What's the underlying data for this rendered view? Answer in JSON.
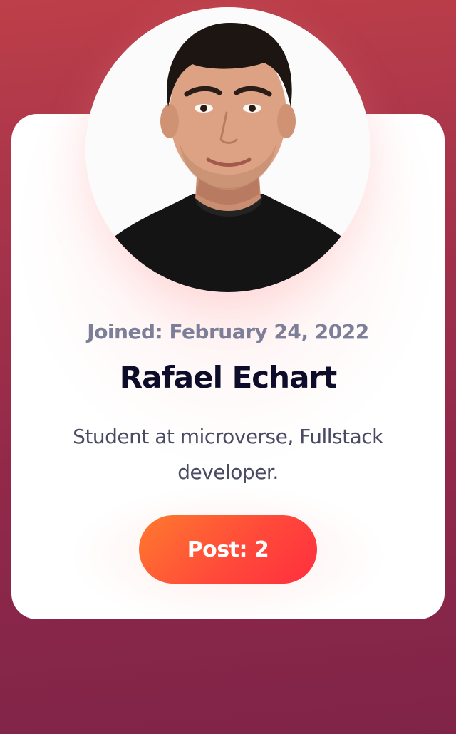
{
  "profile": {
    "joined_label": "Joined: February 24, 2022",
    "name": "Rafael Echart",
    "bio": "Student at microverse, Fullstack developer.",
    "post_button_label": "Post: 2"
  },
  "colors": {
    "background_top": "#bd3f49",
    "background_bottom": "#7f2448",
    "card": "#ffffff",
    "name": "#0d0d2b",
    "joined": "#7c7f97",
    "bio": "#4a4a63",
    "button_start": "#ff7a2e",
    "button_end": "#ff2f3e"
  }
}
